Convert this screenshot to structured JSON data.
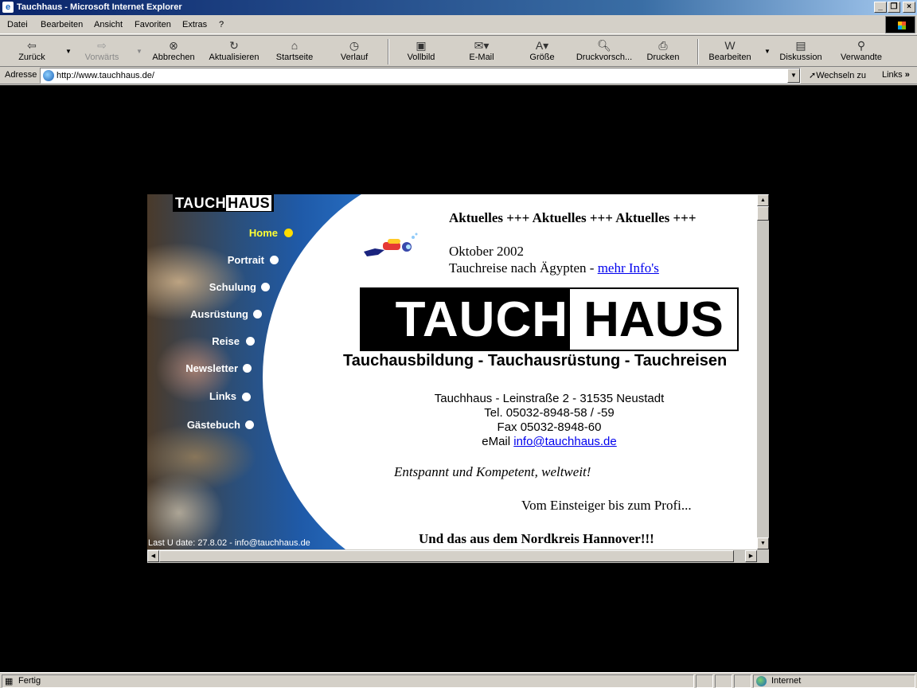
{
  "window": {
    "title": "Tauchhaus - Microsoft Internet Explorer"
  },
  "menu": [
    "Datei",
    "Bearbeiten",
    "Ansicht",
    "Favoriten",
    "Extras",
    "?"
  ],
  "toolbar": {
    "back": "Zurück",
    "forward": "Vorwärts",
    "stop": "Abbrechen",
    "refresh": "Aktualisieren",
    "home": "Startseite",
    "history": "Verlauf",
    "fullscreen": "Vollbild",
    "mail": "E-Mail",
    "size": "Größe",
    "preview": "Druckvorsch...",
    "print": "Drucken",
    "edit": "Bearbeiten",
    "discuss": "Diskussion",
    "related": "Verwandte"
  },
  "address": {
    "label": "Adresse",
    "url": "http://www.tauchhaus.de/",
    "go": "Wechseln zu",
    "links": "Links"
  },
  "site": {
    "logo_left": "TAUCH",
    "logo_right": "HAUS",
    "nav": [
      "Home",
      "Portrait",
      "Schulung",
      "Ausrüstung",
      "Reise",
      "Newsletter",
      "Links",
      "Gästebuch"
    ],
    "last_update": "Last U   date: 27.8.02 - info@tauchhaus.de",
    "news_ticker": "Aktuelles +++ Aktuelles +++ Aktuelles +++",
    "news_month": "Oktober 2002",
    "news_text": "Tauchreise nach Ägypten - ",
    "news_link": "mehr Info's",
    "slogan": "Tauchausbildung - Tauchausrüstung - Tauchreisen",
    "address_line": "Tauchhaus - Leinstraße 2 - 31535 Neustadt",
    "tel": "Tel. 05032-8948-58 / -59",
    "fax": "Fax 05032-8948-60",
    "email_label": "eMail ",
    "email": "info@tauchhaus.de",
    "motto1": "Entspannt und Kompetent, weltweit!",
    "motto2": "Vom Einsteiger bis zum Profi...",
    "motto3": "Und das aus dem Nordkreis Hannover!!!"
  },
  "status": {
    "text": "Fertig",
    "zone": "Internet"
  }
}
